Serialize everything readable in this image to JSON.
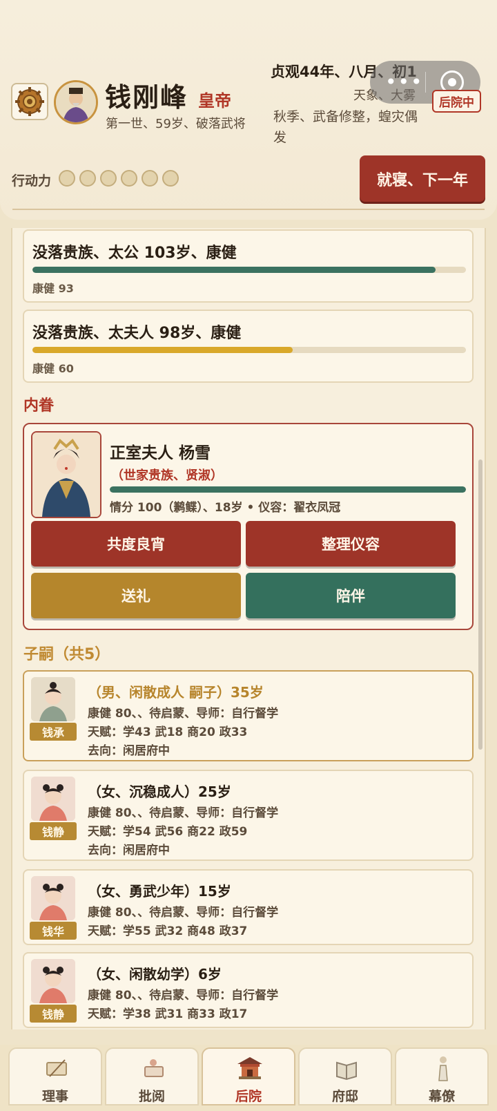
{
  "header": {
    "player_name": "钱刚峰",
    "player_title": "皇帝",
    "player_sub": "第一世、59岁、破落武将",
    "date": "贞观44年、八月、初1",
    "weather": "天象、大雾",
    "events": "秋季、武备修整，蝗灾偶发",
    "location_badge": "后院中",
    "action_label": "行动力",
    "action_points_total": 6,
    "action_points_used": 0,
    "sleep_button": "就寝、下一年"
  },
  "elders": [
    {
      "title": "没落贵族、太公 103岁、康健",
      "health_label": "康健 93",
      "health": 93,
      "color": "#3b7260"
    },
    {
      "title": "没落贵族、太夫人 98岁、康健",
      "health_label": "康健 60",
      "health": 60,
      "color": "#d9a82a"
    }
  ],
  "spouse_section": {
    "title": "内眷",
    "color": "#b03626"
  },
  "spouse": {
    "name": "正室夫人 杨雪",
    "trait": "（世家贵族、贤淑）",
    "affection": 100,
    "stats": "情分 100（鹣鲽）、18岁 • 仪容：翟衣凤冠",
    "buttons": {
      "together": "共度良宵",
      "groom": "整理仪容",
      "gift": "送礼",
      "accompany": "陪伴"
    }
  },
  "children_section": {
    "title": "子嗣（共5）",
    "color": "#c08a32"
  },
  "children": [
    {
      "name": "钱承",
      "title": "（男、闲散成人 嗣子）35岁",
      "health": "康健 80、、待启蒙、导师：自行督学",
      "talent": "天赋：学43 武18 商20 政33",
      "destination": "去向：闲居府中"
    },
    {
      "name": "钱静",
      "title": "（女、沉稳成人）25岁",
      "health": "康健 80、、待启蒙、导师：自行督学",
      "talent": "天赋：学54 武56 商22 政59",
      "destination": "去向：闲居府中"
    },
    {
      "name": "钱华",
      "title": "（女、勇武少年）15岁",
      "health": "康健 80、、待启蒙、导师：自行督学",
      "talent": "天赋：学55 武32 商48 政37"
    },
    {
      "name": "钱静",
      "title": "（女、闲散幼学）6岁",
      "health": "康健 80、、待启蒙、导师：自行督学",
      "talent": "天赋：学38 武31 商33 政17"
    }
  ],
  "nav": {
    "items": [
      {
        "label": "理事",
        "icon": "scroll-icon"
      },
      {
        "label": "批阅",
        "icon": "document-icon"
      },
      {
        "label": "后院",
        "icon": "pavilion-icon",
        "active": true
      },
      {
        "label": "府邸",
        "icon": "book-icon"
      },
      {
        "label": "幕僚",
        "icon": "advisor-icon"
      }
    ]
  }
}
